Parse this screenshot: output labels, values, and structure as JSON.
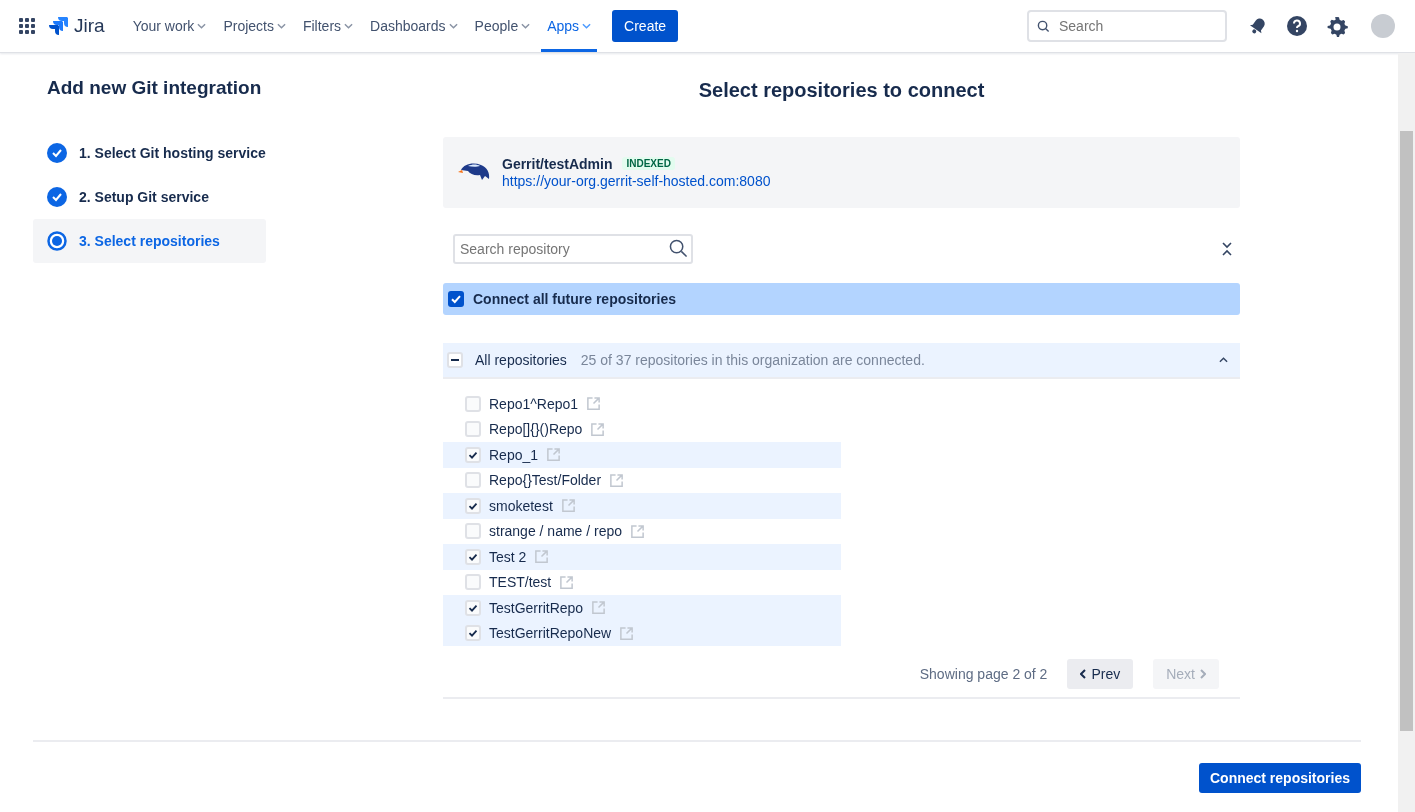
{
  "nav": {
    "product": "Jira",
    "items": [
      {
        "label": "Your work",
        "selected": false
      },
      {
        "label": "Projects",
        "selected": false
      },
      {
        "label": "Filters",
        "selected": false
      },
      {
        "label": "Dashboards",
        "selected": false
      },
      {
        "label": "People",
        "selected": false
      },
      {
        "label": "Apps",
        "selected": true
      }
    ],
    "create": "Create",
    "search": {
      "placeholder": "Search"
    }
  },
  "sidebar": {
    "title": "Add new Git integration",
    "steps": [
      {
        "label": "1. Select Git hosting service",
        "kind": "done",
        "selected": false
      },
      {
        "label": "2. Setup Git service",
        "kind": "done",
        "selected": false
      },
      {
        "label": "3. Select repositories",
        "kind": "current",
        "selected": true
      }
    ]
  },
  "main": {
    "title": "Select repositories to connect",
    "service": {
      "name": "Gerrit/testAdmin",
      "badge": "INDEXED",
      "url": "https://your-org.gerrit-self-hosted.com:8080"
    },
    "search": {
      "placeholder": "Search repository"
    },
    "connect_future": {
      "label": "Connect all future repositories",
      "checked": true
    },
    "all_repos": {
      "label": "All repositories",
      "summary": "25 of 37 repositories in this organization are connected.",
      "indeterminate": true,
      "expanded": true
    },
    "repositories": [
      {
        "name": "Repo1^Repo1",
        "checked": false
      },
      {
        "name": "Repo[]{}()Repo",
        "checked": false
      },
      {
        "name": "Repo_1",
        "checked": true
      },
      {
        "name": "Repo{}Test/Folder",
        "checked": false
      },
      {
        "name": "smoketest",
        "checked": true
      },
      {
        "name": "strange / name / repo",
        "checked": false
      },
      {
        "name": "Test 2",
        "checked": true
      },
      {
        "name": "TEST/test",
        "checked": false
      },
      {
        "name": "TestGerritRepo",
        "checked": true
      },
      {
        "name": "TestGerritRepoNew",
        "checked": true
      }
    ],
    "pagination": {
      "status": "Showing page 2 of 2",
      "prev": {
        "label": "Prev",
        "disabled": false
      },
      "next": {
        "label": "Next",
        "disabled": true
      }
    }
  },
  "footer": {
    "button": "Connect repositories"
  }
}
